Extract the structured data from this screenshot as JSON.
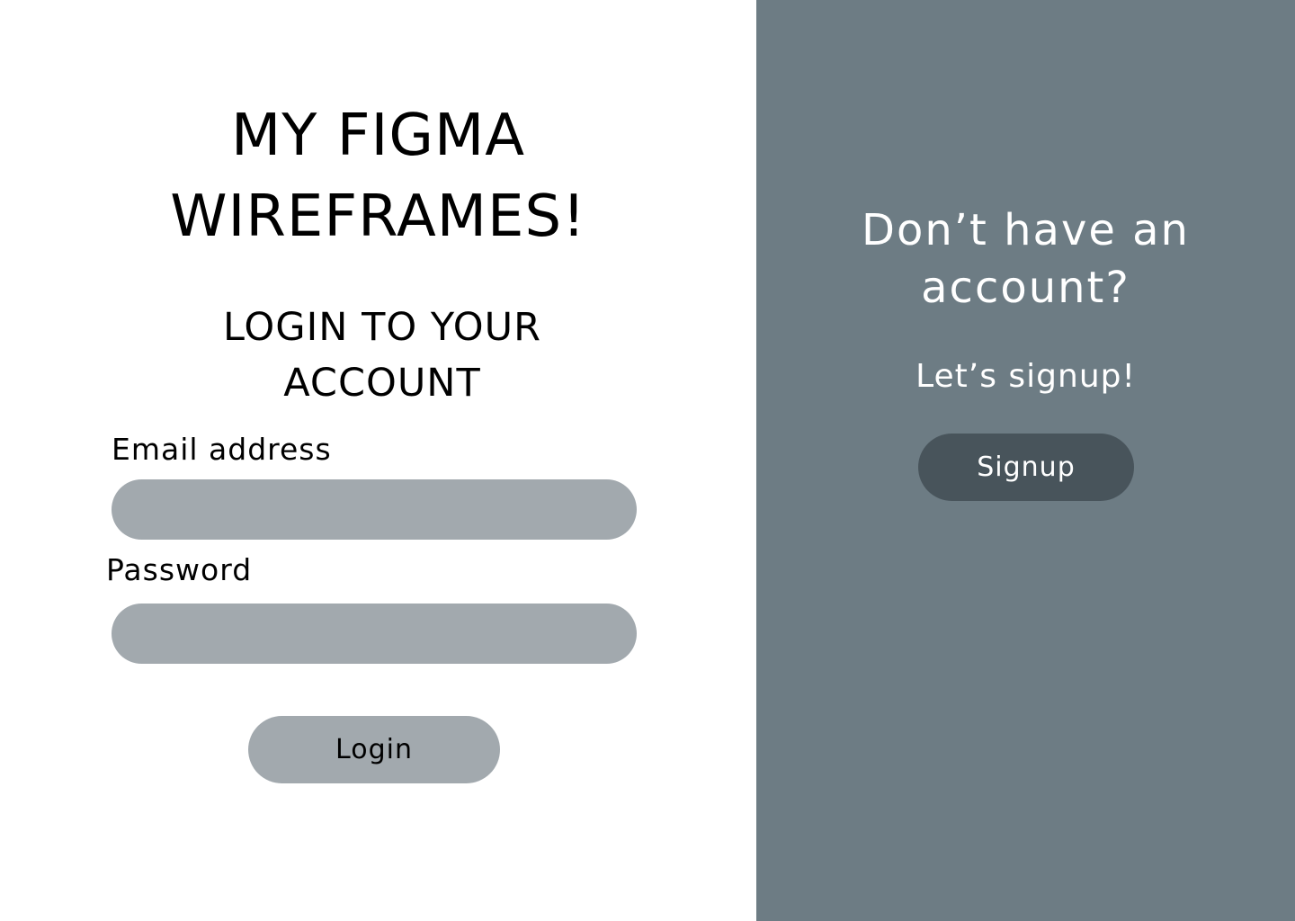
{
  "colors": {
    "background": "#ffffff",
    "side_panel": "#6d7c84",
    "input_fill": "#a2a9ae",
    "login_button": "#a2a9ae",
    "signup_button": "#48545b",
    "text_dark": "#000000",
    "text_light": "#ffffff"
  },
  "login": {
    "title_line1": "MY FIGMA",
    "title_line2": "WIREFRAMES!",
    "heading_line1": "LOGIN TO YOUR",
    "heading_line2": "ACCOUNT",
    "email_label": "Email address",
    "email_value": "",
    "password_label": "Password",
    "password_value": "",
    "button_label": "Login"
  },
  "signup": {
    "heading_line1": "Don’t have an",
    "heading_line2": "account?",
    "subtext": "Let’s signup!",
    "button_label": "Signup"
  }
}
